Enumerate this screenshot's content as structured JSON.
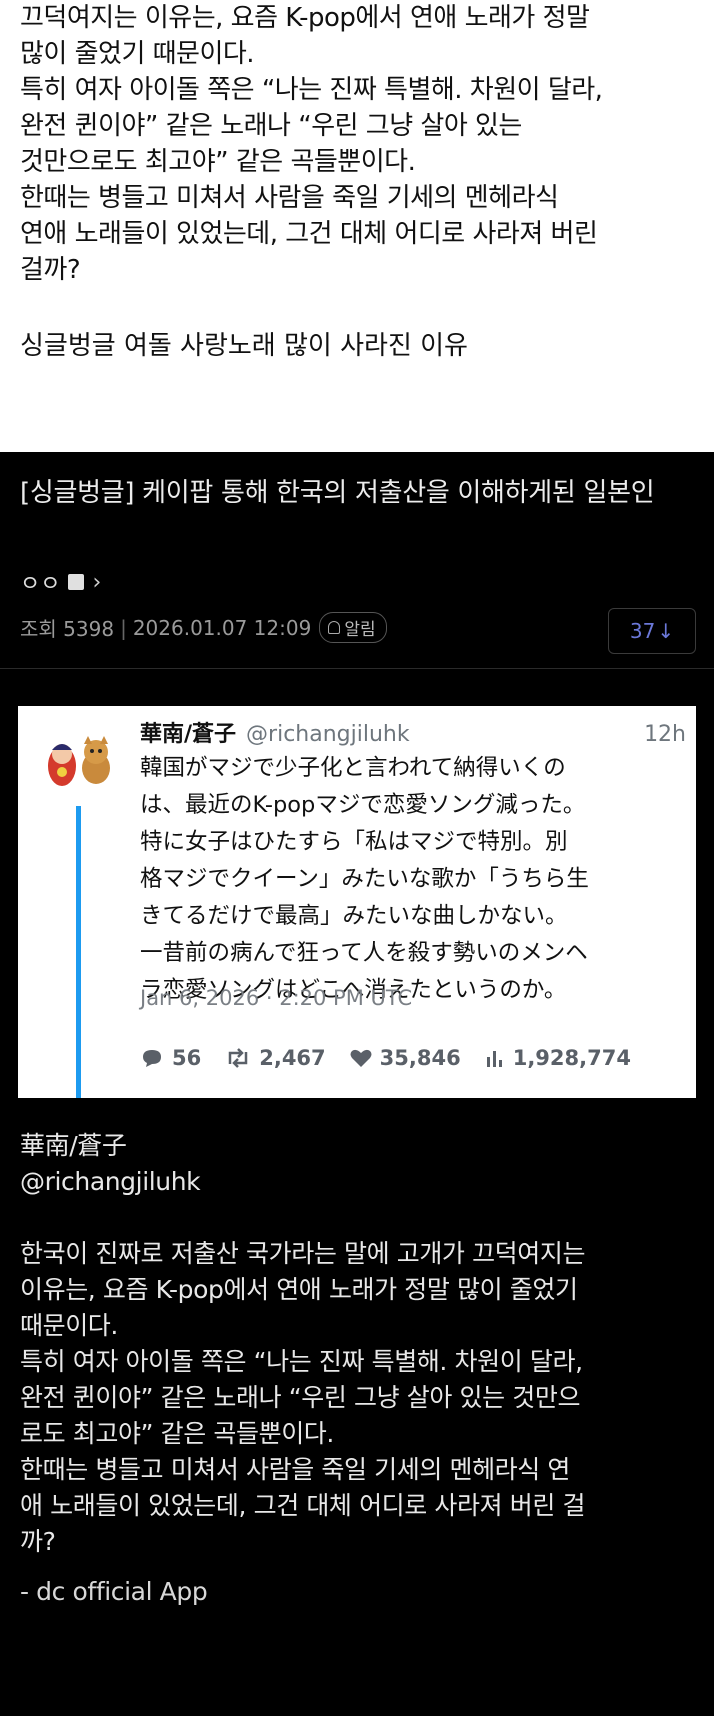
{
  "top_text": {
    "lines": [
      "끄덕여지는 이유는, 요즘 K-pop에서 연애 노래가 정말",
      "많이 줄었기 때문이다.",
      "특히 여자 아이돌 쪽은 “나는 진짜 특별해. 차원이 달라,",
      "완전 퀸이야” 같은 노래나 “우린 그냥 살아 있는",
      "것만으로도 최고야” 같은 곡들뿐이다.",
      "한때는 병들고 미쳐서 사람을 죽일 기세의 멘헤라식",
      "연애 노래들이 있었는데, 그건 대체 어디로 사라져 버린",
      "걸까?"
    ],
    "title": "싱글벙글 여돌 사랑노래 많이 사라진 이유"
  },
  "post": {
    "title": "[싱글벙글] 케이팝 통해 한국의 저출산을 이해하게된 일본인",
    "author": "ㅇㅇ",
    "views": "조회 5398",
    "date": "2026.01.07 12:09",
    "alarm_label": "알림",
    "comment_count": "37",
    "comment_arrow": "↓"
  },
  "tweet": {
    "name": "華南/蒼子",
    "handle": "@richangjiluhk",
    "time": "12h",
    "body_lines": [
      "韓国がマジで少子化と言われて納得いくの",
      "は、最近のK-popマジで恋愛ソング減った。",
      "特に女子はひたすら「私はマジで特別。別",
      "格マジでクイーン」みたいな歌か「うちら生",
      "きてるだけで最高」みたいな曲しかない。",
      "一昔前の病んで狂って人を殺す勢いのメンヘ",
      "ラ恋愛ソングはどこへ消えたというのか。"
    ],
    "date": "Jan 6, 2026 · 2:20 PM UTC",
    "replies": "56",
    "retweets": "2,467",
    "likes": "35,846",
    "views": "1,928,774"
  },
  "body": {
    "author": "華南/蒼子",
    "handle": "@richangjiluhk",
    "lines": [
      "한국이 진짜로 저출산 국가라는 말에 고개가 끄덕여지는",
      "이유는, 요즘 K-pop에서 연애 노래가 정말 많이 줄었기",
      "때문이다.",
      "특히 여자 아이돌 쪽은 “나는 진짜 특별해. 차원이 달라,",
      "완전 퀸이야” 같은 노래나 “우린 그냥 살아 있는 것만으",
      "로도 최고야” 같은 곡들뿐이다.",
      "한때는 병들고 미쳐서 사람을 죽일 기세의 멘헤라식 연",
      "애 노래들이 있었는데, 그건 대체 어디로 사라져 버린 걸",
      "까?"
    ],
    "signature": "- dc official App"
  },
  "colors": {
    "dark_bg": "#000000",
    "accent_blue": "#6b78d8",
    "twitter_blue": "#1d9bf0"
  }
}
